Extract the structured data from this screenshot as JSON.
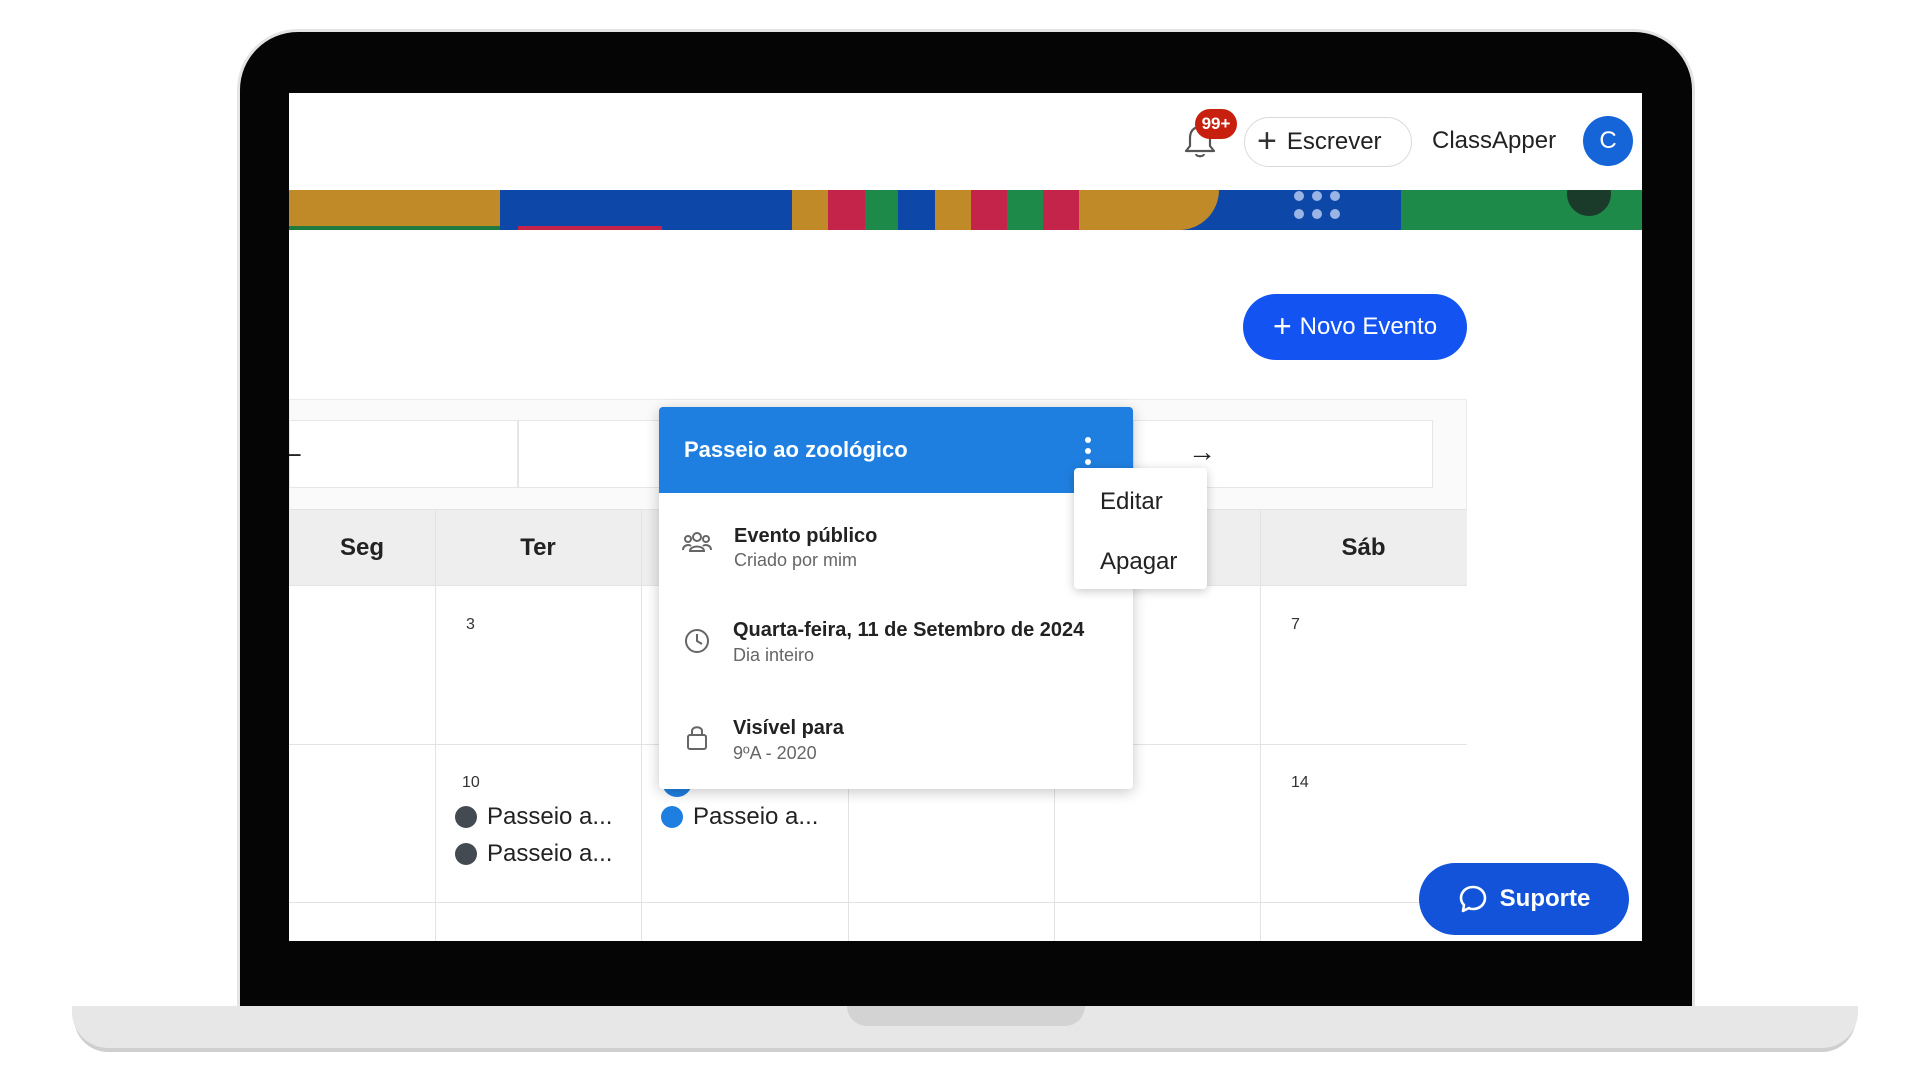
{
  "header": {
    "notifications_badge": "99+",
    "write_label": "Escrever",
    "user_name": "ClassApper",
    "avatar_initial": "C"
  },
  "toolbar": {
    "new_event_label": "Novo Evento"
  },
  "calendar": {
    "day_names": [
      "Seg",
      "Ter",
      "Sáb"
    ],
    "day_numbers": {
      "d3": "3",
      "d7": "7",
      "d10": "10",
      "d14": "14"
    },
    "events": [
      {
        "label": "Passeio a...",
        "color": "#444a52"
      },
      {
        "label": "Passeio a...",
        "color": "#444a52"
      },
      {
        "label": "Passeio a...",
        "color": "#1f7fe0"
      }
    ]
  },
  "event_popup": {
    "title": "Passeio ao zoológico",
    "visibility_type": "Evento público",
    "created_by": "Criado por mim",
    "date": "Quarta-feira, 11 de Setembro de 2024",
    "duration": "Dia inteiro",
    "visible_to_label": "Visível para",
    "visible_to_value": "9ºA - 2020"
  },
  "context_menu": {
    "edit_label": "Editar",
    "delete_label": "Apagar"
  },
  "support": {
    "label": "Suporte"
  },
  "colors": {
    "primary": "#1253f2",
    "popup_header": "#1f7fe0",
    "badge": "#c8200f"
  }
}
